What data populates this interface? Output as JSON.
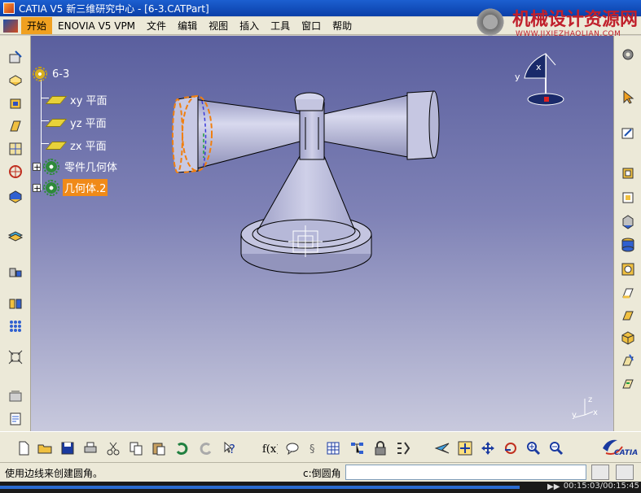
{
  "window": {
    "title": "CATIA V5  新三维研究中心 - [6-3.CATPart]"
  },
  "menu": {
    "items": [
      {
        "label": "开始"
      },
      {
        "label": "ENOVIA V5 VPM"
      },
      {
        "label": "文件"
      },
      {
        "label": "编辑"
      },
      {
        "label": "视图"
      },
      {
        "label": "插入"
      },
      {
        "label": "工具"
      },
      {
        "label": "窗口"
      },
      {
        "label": "帮助"
      }
    ]
  },
  "watermark": {
    "text": "机械设计资源网",
    "url": "WWW.JIXIEZHAOLIAN.COM"
  },
  "tree": {
    "root": "6-3",
    "items": [
      {
        "label": "xy 平面",
        "icon": "plane-icon"
      },
      {
        "label": "yz 平面",
        "icon": "plane-icon"
      },
      {
        "label": "zx 平面",
        "icon": "plane-icon"
      },
      {
        "label": "零件几何体",
        "icon": "part-body-icon"
      },
      {
        "label": "几何体.2",
        "icon": "body-icon",
        "selected": true
      }
    ]
  },
  "compass": {
    "x": "x",
    "y": "y"
  },
  "axis_triad": {
    "x": "x",
    "y": "y",
    "z": "z"
  },
  "status": {
    "message": "使用边线来创建圆角。",
    "command_label": "c:倒圆角",
    "command_value": ""
  },
  "logo": {
    "text": "CATIA"
  },
  "timeline": {
    "time": "00:15:03/00:15:45",
    "progress": 0.955
  },
  "colors": {
    "highlight": "#f08a18",
    "model_fill": "#c4c5e0",
    "selection_edge": "#f07f10",
    "bg_top": "#5a5f9e",
    "bg_bottom": "#c8c9dd"
  }
}
